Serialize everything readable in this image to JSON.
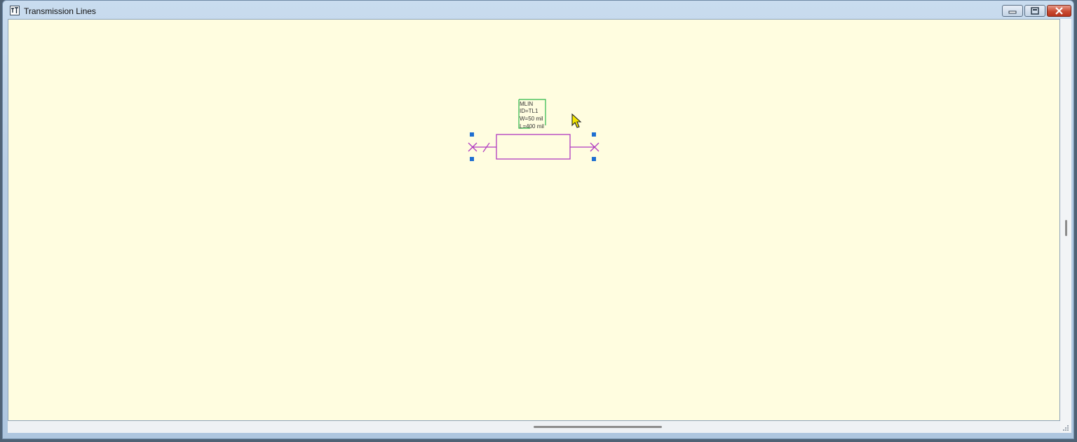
{
  "window": {
    "title": "Transmission Lines"
  },
  "colors": {
    "canvas_background": "#fffde0",
    "component": "#b03ac0",
    "label_box": "#2db84a",
    "selection_handle": "#1f6fd1"
  },
  "component": {
    "labels": [
      "MLIN",
      "ID=TL1",
      "W=50 mil",
      "L=400 mil"
    ]
  },
  "icons": {
    "app": "schematic-app-icon",
    "minimize": "minimize-icon",
    "maximize": "maximize-icon",
    "close": "close-icon",
    "cursor": "mouse-pointer-icon"
  }
}
